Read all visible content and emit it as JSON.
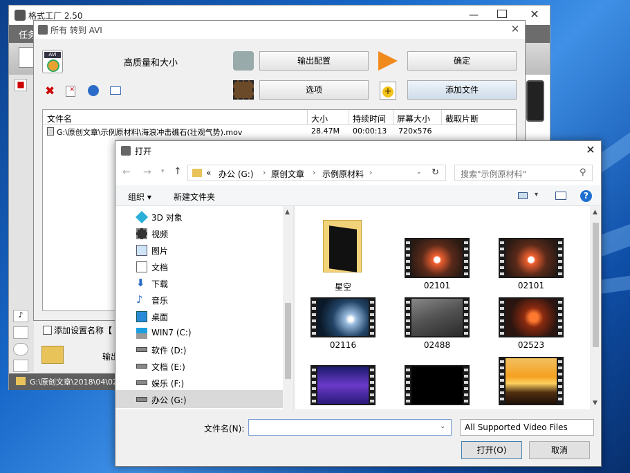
{
  "app_window": {
    "title": "格式工厂 2.50",
    "menu_label": "任务",
    "status_path": "G:\\原创文章\\2018\\04\\02"
  },
  "convert_dialog": {
    "title": "所有 转到 AVI",
    "quality_label": "高质量和大小",
    "output_config_button": "输出配置",
    "ok_button": "确定",
    "options_button": "选项",
    "add_file_button": "添加文件",
    "columns": [
      "文件名",
      "大小",
      "持续时间",
      "屏幕大小",
      "截取片断"
    ],
    "files": [
      {
        "name": "G:\\原创文章\\示例原材料\\海浪冲击礁石(壮观气势).mov",
        "size": "28.47M",
        "duration": "00:00:13",
        "resolution": "720x576",
        "clip": ""
      }
    ],
    "add_setting_label": "添加设置名称【",
    "output_label": "输出"
  },
  "open_dialog": {
    "title": "打开",
    "breadcrumb": [
      "«",
      "办公 (G:)",
      "原创文章",
      "示例原材料"
    ],
    "search_placeholder": "搜索\"示例原材料\"",
    "organize_label": "组织 ▾",
    "new_folder_label": "新建文件夹",
    "nav_items": [
      {
        "label": "3D 对象",
        "icon": "cube-icon"
      },
      {
        "label": "视频",
        "icon": "video-icon"
      },
      {
        "label": "图片",
        "icon": "picture-icon"
      },
      {
        "label": "文档",
        "icon": "document-icon"
      },
      {
        "label": "下载",
        "icon": "download-icon"
      },
      {
        "label": "音乐",
        "icon": "music-icon"
      },
      {
        "label": "桌面",
        "icon": "desktop-icon"
      },
      {
        "label": "WIN7 (C:)",
        "icon": "windows-drive-icon"
      },
      {
        "label": "软件 (D:)",
        "icon": "drive-icon"
      },
      {
        "label": "文档 (E:)",
        "icon": "drive-icon"
      },
      {
        "label": "娱乐 (F:)",
        "icon": "drive-icon"
      },
      {
        "label": "办公 (G:)",
        "icon": "drive-icon"
      }
    ],
    "items": [
      {
        "label": "星空",
        "type": "folder"
      },
      {
        "label": "02101",
        "type": "video"
      },
      {
        "label": "02101",
        "type": "video"
      },
      {
        "label": "02116",
        "type": "video"
      },
      {
        "label": "02488",
        "type": "video"
      },
      {
        "label": "02523",
        "type": "video"
      },
      {
        "label": "",
        "type": "video"
      },
      {
        "label": "",
        "type": "video"
      },
      {
        "label": "",
        "type": "video"
      }
    ],
    "filename_label": "文件名(N):",
    "filename_value": "",
    "filter_value": "All Supported Video Files",
    "open_button": "打开(O)",
    "cancel_button": "取消"
  },
  "colors": {
    "desktop_blue": "#1667c8",
    "selected_nav": "#cce8ff",
    "accent_orange": "#f08a1c"
  }
}
